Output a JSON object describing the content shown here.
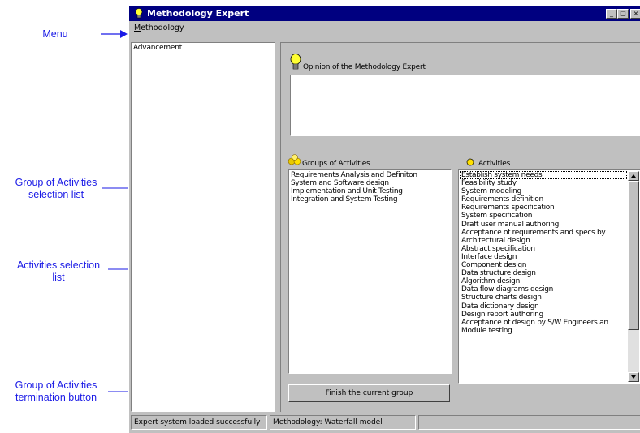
{
  "annotations": {
    "menu": "Menu",
    "groups_list": [
      "Group of Activities",
      "selection list"
    ],
    "activities_list": [
      "Activities selection",
      "list"
    ],
    "termination_button": [
      "Group of Activities",
      "termination button"
    ]
  },
  "window": {
    "title": "Methodology Expert",
    "controls": [
      "_",
      "□",
      "×"
    ]
  },
  "menu": {
    "methodology_accel": "M",
    "methodology_rest": "ethodology"
  },
  "advancement": {
    "label": "Advancement"
  },
  "opinion": {
    "label": "Opinion of the Methodology Expert",
    "icon": "lightbulb-icon",
    "text": ""
  },
  "groups": {
    "label": "Groups of Activities",
    "icon": "circles-group-icon",
    "items": [
      "Requirements Analysis and Definiton",
      "System and Software design",
      "Implementation and Unit Testing",
      "Integration and System Testing"
    ]
  },
  "activities": {
    "label": "Activities",
    "icon": "yellow-dot-icon",
    "items": [
      "Establish system needs",
      "Feasibility study",
      "System modeling",
      "Requirements definition",
      "Requirements specification",
      "System specification",
      "Draft user manual authoring",
      "Acceptance of requirements and specs by",
      "Architectural design",
      "Abstract specification",
      "Interface design",
      "Component design",
      "Data structure design",
      "Algorithm design",
      "Data flow diagrams design",
      "Structure charts design",
      "Data dictionary design",
      "Design report authoring",
      "Acceptance of design by S/W Engineers an",
      "Module testing"
    ]
  },
  "finish_button": {
    "label": "Finish the current group"
  },
  "statusbar": {
    "message": "Expert system loaded successfully",
    "model": "Methodology: Waterfall model"
  },
  "colors": {
    "annotation": "#1a1ae6",
    "titlebar": "#000080",
    "face": "#c0c0c0"
  }
}
